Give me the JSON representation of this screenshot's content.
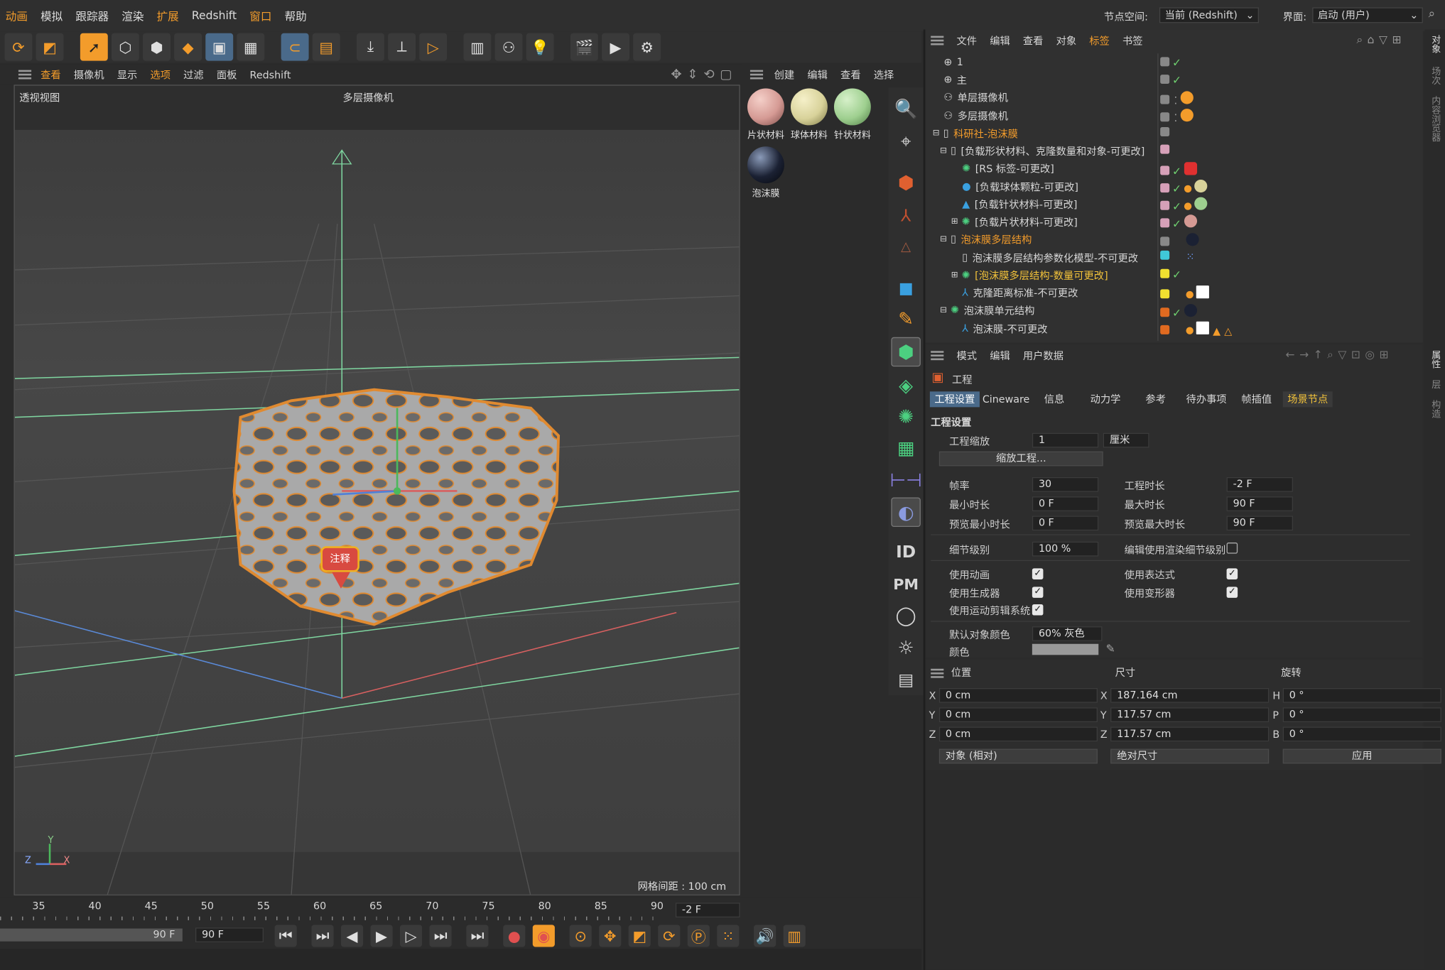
{
  "menubar": {
    "items": [
      "动画",
      "模拟",
      "跟踪器",
      "渲染",
      "扩展",
      "Redshift",
      "窗口",
      "帮助"
    ],
    "node_space_label": "节点空间:",
    "node_space_value": "当前 (Redshift)",
    "interface_label": "界面:",
    "interface_value": "启动 (用户)"
  },
  "viewport": {
    "menu": [
      "查看",
      "摄像机",
      "显示",
      "选项",
      "过滤",
      "面板",
      "Redshift"
    ],
    "view_name": "透视视图",
    "camera_name": "多层摄像机",
    "grid_spacing": "网格间距 : 100 cm",
    "annotation": "注释",
    "axis_labels": {
      "y": "Y",
      "z": "Z",
      "x": "X"
    }
  },
  "material_panel": {
    "menu": [
      "创建",
      "编辑",
      "查看",
      "选择"
    ],
    "materials": [
      {
        "name": "片状材料",
        "color": "#d59a94"
      },
      {
        "name": "球体材料",
        "color": "#d8d29a"
      },
      {
        "name": "针状材料",
        "color": "#9ecf8f"
      },
      {
        "name": "泡沫膜",
        "color": "#1b2133"
      }
    ]
  },
  "object_manager": {
    "menu": [
      "文件",
      "编辑",
      "查看",
      "对象",
      "标签",
      "书签"
    ],
    "rows": [
      {
        "name": "1",
        "indent": 0,
        "color": "#d6d6d6"
      },
      {
        "name": "主",
        "indent": 0,
        "color": "#d6d6d6"
      },
      {
        "name": "单层摄像机",
        "indent": 0,
        "color": "#d6d6d6"
      },
      {
        "name": "多层摄像机",
        "indent": 0,
        "color": "#d6d6d6"
      },
      {
        "name": "科研社-泡沫膜",
        "indent": 0,
        "color": "#f39c2b"
      },
      {
        "name": "[负载形状材料、克隆数量和对象-可更改]",
        "indent": 1,
        "color": "#d6d6d6"
      },
      {
        "name": "[RS 标签-可更改]",
        "indent": 2,
        "color": "#d6d6d6"
      },
      {
        "name": "[负载球体颗粒-可更改]",
        "indent": 2,
        "color": "#d6d6d6"
      },
      {
        "name": "[负载针状材料-可更改]",
        "indent": 2,
        "color": "#d6d6d6"
      },
      {
        "name": "[负载片状材料-可更改]",
        "indent": 2,
        "color": "#d6d6d6"
      },
      {
        "name": "泡沫膜多层结构",
        "indent": 1,
        "color": "#f39c2b"
      },
      {
        "name": "泡沫膜多层结构参数化模型-不可更改",
        "indent": 2,
        "color": "#d6d6d6"
      },
      {
        "name": "[泡沫膜多层结构-数量可更改]",
        "indent": 2,
        "color": "#f2c23a"
      },
      {
        "name": "克隆距离标准-不可更改",
        "indent": 2,
        "color": "#d6d6d6"
      },
      {
        "name": "泡沫膜单元结构",
        "indent": 1,
        "color": "#d6d6d6"
      },
      {
        "name": "泡沫膜-不可更改",
        "indent": 2,
        "color": "#d6d6d6"
      }
    ]
  },
  "attributes": {
    "menu": [
      "模式",
      "编辑",
      "用户数据"
    ],
    "object_name": "工程",
    "tabs": [
      "工程设置",
      "Cineware",
      "信息",
      "动力学",
      "参考",
      "待办事项",
      "帧插值",
      "场景节点"
    ],
    "section": "工程设置",
    "scale_label": "工程缩放",
    "scale_value": "1",
    "scale_unit": "厘米",
    "scale_button": "缩放工程...",
    "fps_label": "帧率",
    "fps_value": "30",
    "duration_label": "工程时长",
    "duration_value": "-2 F",
    "min_label": "最小时长",
    "min_value": "0 F",
    "max_label": "最大时长",
    "max_value": "90 F",
    "pmin_label": "预览最小时长",
    "pmin_value": "0 F",
    "pmax_label": "预览最大时长",
    "pmax_value": "90 F",
    "lod_label": "细节级别",
    "lod_value": "100 %",
    "render_lod_label": "编辑使用渲染细节级别",
    "anim_label": "使用动画",
    "expr_label": "使用表达式",
    "gen_label": "使用生成器",
    "deform_label": "使用变形器",
    "motion_label": "使用运动剪辑系统",
    "defcolor_label": "默认对象颜色",
    "defcolor_value": "60% 灰色",
    "color_label": "颜色"
  },
  "coords": {
    "headers": [
      "位置",
      "尺寸",
      "旋转"
    ],
    "pos": {
      "x": "0 cm",
      "y": "0 cm",
      "z": "0 cm"
    },
    "size": {
      "x": "187.164 cm",
      "y": "117.57 cm",
      "z": "117.57 cm"
    },
    "rot": {
      "h": "0 °",
      "p": "0 °",
      "b": "0 °"
    },
    "mode": "对象 (相对)",
    "size_mode": "绝对尺寸",
    "apply": "应用"
  },
  "timeline": {
    "ticks": [
      "35",
      "40",
      "45",
      "50",
      "55",
      "60",
      "65",
      "70",
      "75",
      "80",
      "85",
      "90"
    ],
    "current": "-2 F",
    "end_a": "90 F",
    "end_b": "90 F"
  },
  "right_tabs": [
    "对象",
    "场次",
    "内容浏览器",
    "属性",
    "层",
    "构造"
  ],
  "tool_text": {
    "id": "ID",
    "pm": "PM"
  }
}
